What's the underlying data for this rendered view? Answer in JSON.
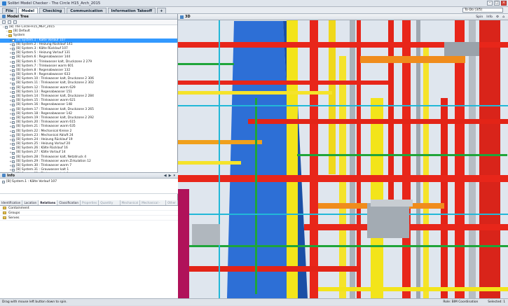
{
  "window": {
    "title": "Solibri Model Checker - The Circle H15_Arch_2015"
  },
  "menu": {
    "tabs": [
      "File",
      "Model",
      "Checking",
      "Communication",
      "Information Takeoff",
      "+"
    ],
    "active": "Model"
  },
  "todo": {
    "value": "To-Do (3/5)"
  },
  "model_tree": {
    "title": "Model Tree",
    "nodes": [
      {
        "label": "[B] The Circle-H15_MEP_2015",
        "level": 0,
        "kind": "model"
      },
      {
        "label": "[B] Default",
        "level": 1,
        "kind": "folder"
      },
      {
        "label": "System",
        "level": 1,
        "kind": "folder"
      },
      {
        "label": "[B] System.1 : Kälte Vorlauf 107",
        "level": 2,
        "kind": "item",
        "selected": true
      },
      {
        "label": "[B] System.2 : Heizung Rücklauf 141",
        "level": 2,
        "kind": "item"
      },
      {
        "label": "[B] System.3 : Kälte Rücklauf 107",
        "level": 2,
        "kind": "item"
      },
      {
        "label": "[B] System.5 : Heizung Vorlauf 131",
        "level": 2,
        "kind": "item"
      },
      {
        "label": "[B] System.6 : Regenabwasser 144",
        "level": 2,
        "kind": "item"
      },
      {
        "label": "[B] System.6 : Trinkwasser kalt, Druckzone 2 279",
        "level": 2,
        "kind": "item"
      },
      {
        "label": "[B] System.7 : Trinkwasser warm 601",
        "level": 2,
        "kind": "item"
      },
      {
        "label": "[B] System.8 : Regenabwasser 132",
        "level": 2,
        "kind": "item"
      },
      {
        "label": "[B] System.9 : Regenabwasser 633",
        "level": 2,
        "kind": "item"
      },
      {
        "label": "[B] System.10 : Trinkwasser kalt, Druckzone 2 306",
        "level": 2,
        "kind": "item"
      },
      {
        "label": "[B] System.11 : Trinkwasser kalt, Druckzone 2 302",
        "level": 2,
        "kind": "item"
      },
      {
        "label": "[B] System.12 : Trinkwasser warm 629",
        "level": 2,
        "kind": "item"
      },
      {
        "label": "[B] System.13 : Regenabwasser 151",
        "level": 2,
        "kind": "item"
      },
      {
        "label": "[B] System.14 : Trinkwasser kalt, Druckzone 2 284",
        "level": 2,
        "kind": "item"
      },
      {
        "label": "[B] System.15 : Trinkwasser warm 621",
        "level": 2,
        "kind": "item"
      },
      {
        "label": "[B] System.16 : Regenabwasser 148",
        "level": 2,
        "kind": "item"
      },
      {
        "label": "[B] System.17 : Trinkwasser kalt, Druckzone 3 265",
        "level": 2,
        "kind": "item"
      },
      {
        "label": "[B] System.18 : Regenabwasser 142",
        "level": 2,
        "kind": "item"
      },
      {
        "label": "[B] System.19 : Trinkwasser kalt, Druckzone 2 292",
        "level": 2,
        "kind": "item"
      },
      {
        "label": "[B] System.20 : Trinkwasser warm 615",
        "level": 2,
        "kind": "item"
      },
      {
        "label": "[B] System.21 : Trinkwasser warm 635",
        "level": 2,
        "kind": "item"
      },
      {
        "label": "[B] System.22 : Mechanical Kreise 2",
        "level": 2,
        "kind": "item"
      },
      {
        "label": "[B] System.23 : Mechanical Abluft 24",
        "level": 2,
        "kind": "item"
      },
      {
        "label": "[B] System.24 : Heizung Rücklauf 19",
        "level": 2,
        "kind": "item"
      },
      {
        "label": "[B] System.25 : Heizung Vorlauf 20",
        "level": 2,
        "kind": "item"
      },
      {
        "label": "[B] System.26 : Kälte Rücklauf 16",
        "level": 2,
        "kind": "item"
      },
      {
        "label": "[B] System.27 : Kälte Vorlauf 14",
        "level": 2,
        "kind": "item"
      },
      {
        "label": "[B] System.28 : Trinkwasser kalt, Netzdruck 4",
        "level": 2,
        "kind": "item"
      },
      {
        "label": "[B] System.29 : Trinkwasser warm Zirkulation 12",
        "level": 2,
        "kind": "item"
      },
      {
        "label": "[B] System.30 : Trinkwasser warm 7",
        "level": 2,
        "kind": "item"
      },
      {
        "label": "[B] System.31 : Grauwasser kalt 1",
        "level": 2,
        "kind": "item"
      },
      {
        "label": "[B] System.32 : Trinkwasser kalt 1",
        "level": 2,
        "kind": "item"
      }
    ]
  },
  "info": {
    "title": "Info",
    "selected": "[B] System.1 : Kälte Vorlauf 107",
    "tabs": [
      "Identification",
      "Location",
      "Relations",
      "Classification",
      "Properties",
      "Quantity Data",
      "Mechanical",
      "Mechanical - Flow",
      "Other"
    ],
    "active_tab": "Relations",
    "rows": [
      "Containment",
      "Groups",
      "Serves"
    ]
  },
  "view": {
    "title": "3D",
    "controls": [
      "Spin",
      "Info"
    ]
  },
  "status": {
    "hint": "Drag with mouse left button down to spin.",
    "role": "Role: BIM Coordination",
    "selected": "Selected: 1"
  }
}
